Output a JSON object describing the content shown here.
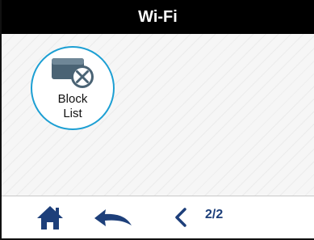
{
  "header": {
    "title": "Wi-Fi"
  },
  "tiles": [
    {
      "label_line1": "Block",
      "label_line2": "List",
      "icon": "block-list-icon"
    }
  ],
  "navigation": {
    "home_icon": "home-icon",
    "back_icon": "back-arrow-icon",
    "prev_icon": "chevron-left-icon",
    "page_indicator": "2/2"
  },
  "colors": {
    "titlebar_background": "#000000",
    "titlebar_text": "#ffffff",
    "tile_border": "#1c9fd3",
    "nav_icon": "#1d3f7a",
    "icon_gray": "#4a6374"
  }
}
